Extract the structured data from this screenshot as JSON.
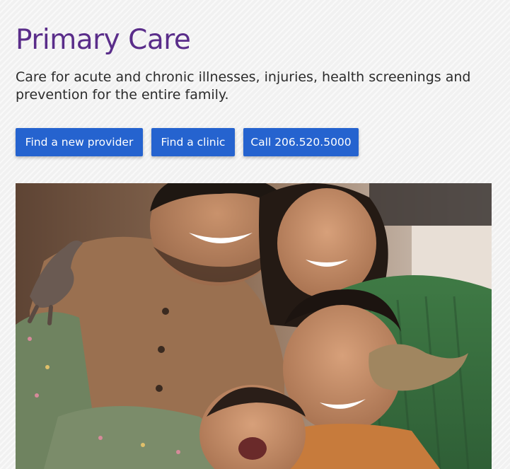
{
  "header": {
    "title": "Primary Care",
    "description": "Care for acute and chronic illnesses, injuries, health screenings and prevention for the entire family."
  },
  "actions": {
    "find_provider_label": "Find a new provider",
    "find_clinic_label": "Find a clinic",
    "call_label": "Call 206.520.5000"
  },
  "colors": {
    "title_purple": "#5a2d8a",
    "button_blue": "#2563cf",
    "background": "#f1f1f1"
  },
  "hero": {
    "subject": "family-photo"
  }
}
